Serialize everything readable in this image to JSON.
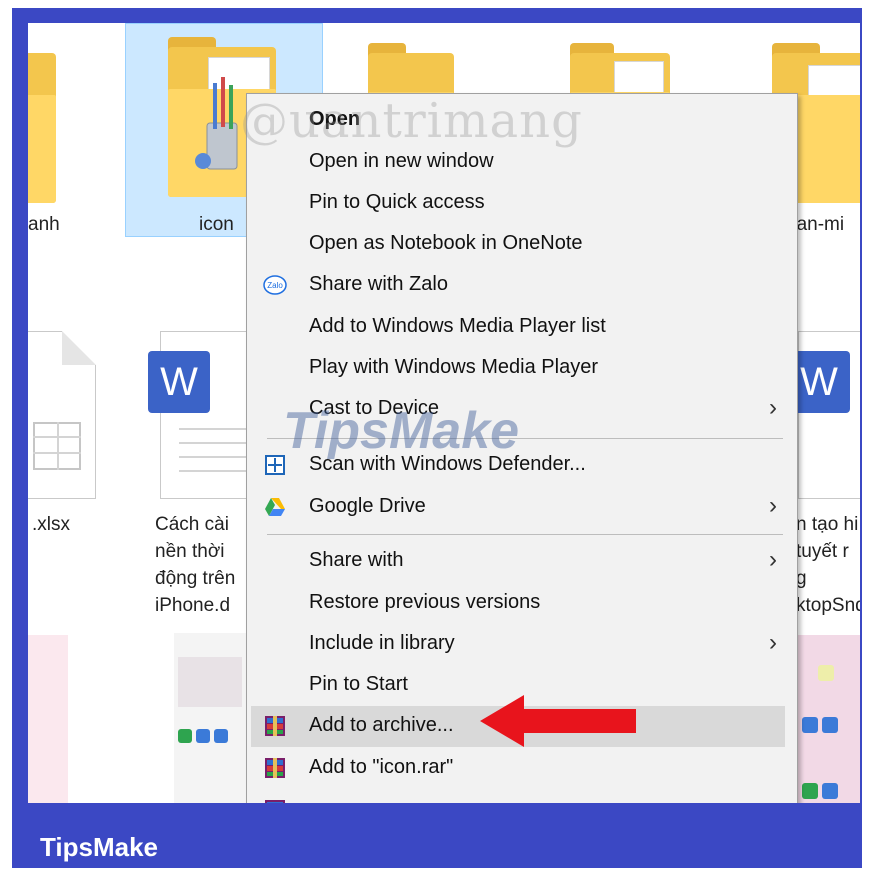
{
  "brand": "TipsMake",
  "watermarks": {
    "top": "@uantrimang",
    "middle": "TipsMake"
  },
  "files": {
    "folder_labels": [
      "anh",
      "icon",
      "han-mi"
    ],
    "doc_labels": {
      "left": ".xlsx",
      "middle": "Cách cài\nnền thời \nđộng trên\niPhone.d",
      "right": "n tạo hi\ntuyết r\ng\nktopSnd"
    }
  },
  "context_menu": {
    "items": [
      {
        "label": "Open",
        "bold": true,
        "icon": "",
        "submenu": false
      },
      {
        "label": "Open in new window",
        "icon": "",
        "submenu": false
      },
      {
        "label": "Pin to Quick access",
        "icon": "",
        "submenu": false
      },
      {
        "label": "Open as Notebook in OneNote",
        "icon": "",
        "submenu": false
      },
      {
        "label": "Share with Zalo",
        "icon": "zalo-icon",
        "submenu": false
      },
      {
        "label": "Add to Windows Media Player list",
        "icon": "",
        "submenu": false
      },
      {
        "label": "Play with Windows Media Player",
        "icon": "",
        "submenu": false
      },
      {
        "label": "Cast to Device",
        "icon": "",
        "submenu": true
      },
      {
        "label": "Scan with Windows Defender...",
        "icon": "windows-defender-icon",
        "submenu": false
      },
      {
        "label": "Google Drive",
        "icon": "google-drive-icon",
        "submenu": true
      },
      {
        "label": "Share with",
        "icon": "",
        "submenu": true
      },
      {
        "label": "Restore previous versions",
        "icon": "",
        "submenu": false
      },
      {
        "label": "Include in library",
        "icon": "",
        "submenu": true
      },
      {
        "label": "Pin to Start",
        "icon": "",
        "submenu": false
      },
      {
        "label": "Add to archive...",
        "icon": "winrar-icon",
        "submenu": false,
        "highlighted": true
      },
      {
        "label": "Add to \"icon.rar\"",
        "icon": "winrar-icon",
        "submenu": false
      }
    ],
    "submenu_glyph": "›",
    "zalo_text": "Zalo"
  },
  "colors": {
    "frame": "#3b48c4",
    "highlight": "#d9d9d9",
    "arrow": "#e8141c",
    "selection": "#cce8ff"
  }
}
